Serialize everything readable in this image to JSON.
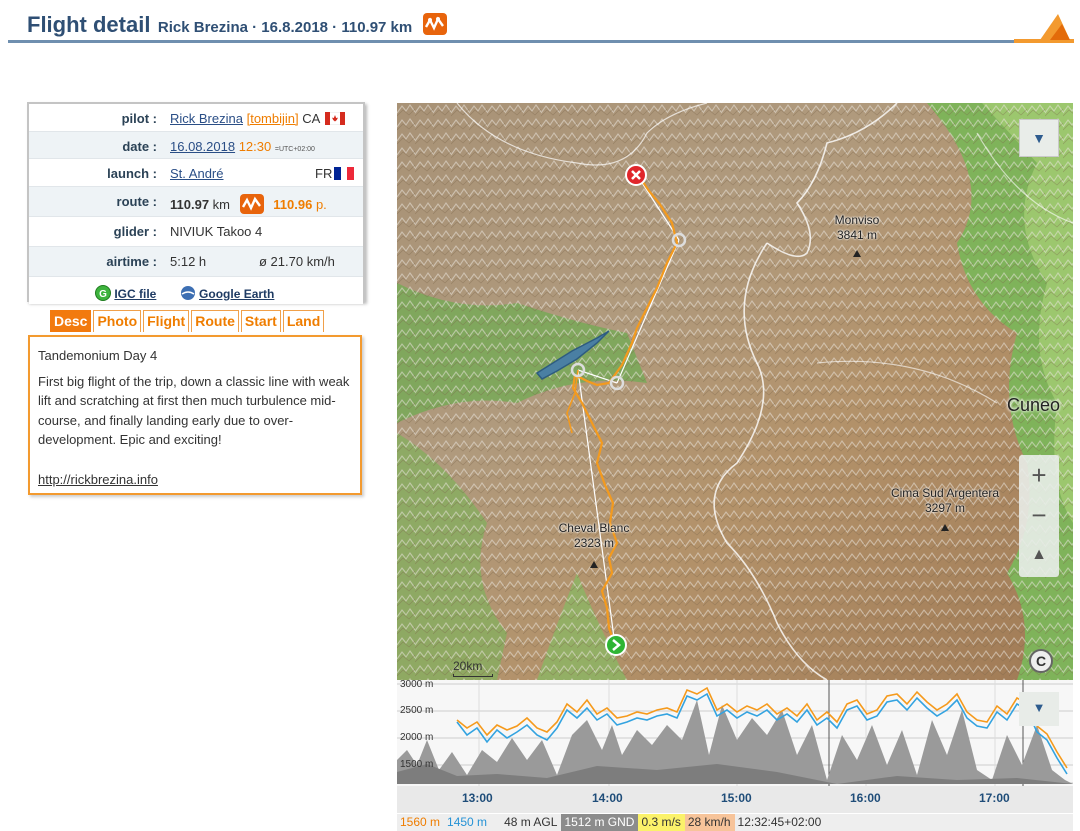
{
  "header": {
    "title": "Flight detail",
    "subtitle": "Rick Brezina · 16.8.2018 · 110.97 km"
  },
  "colors": {
    "accent": "#ef7d00",
    "header_text": "#2f4f74",
    "row_label": "#2b4256"
  },
  "info": {
    "pilot": {
      "label": "pilot :",
      "name": "Rick Brezina",
      "username": "[tombijin]",
      "country": "CA"
    },
    "date": {
      "label": "date :",
      "date": "16.08.2018",
      "time": "12:30",
      "tz": "=UTC+02:00"
    },
    "launch": {
      "label": "launch :",
      "site": "St. André",
      "country": "FR"
    },
    "route": {
      "label": "route :",
      "distance": "110.97",
      "unit": "km",
      "points": "110.96",
      "points_unit": "p."
    },
    "glider": {
      "label": "glider :",
      "value": "NIVIUK Takoo 4"
    },
    "airtime": {
      "label": "airtime :",
      "duration": "5:12 h",
      "speed": "ø 21.70 km/h"
    },
    "files": {
      "igc": "IGC file",
      "google_earth": "Google Earth"
    }
  },
  "tabs": [
    "Desc",
    "Photo",
    "Flight",
    "Route",
    "Start",
    "Land"
  ],
  "active_tab": "Desc",
  "description": {
    "title": "Tandemonium Day 4",
    "body": "First big flight of the trip, down a classic line with weak lift and scratching at first then much turbulence mid-course, and finally landing early due to over-development. Epic and exciting!",
    "url": "http://rickbrezina.info"
  },
  "map": {
    "peaks": [
      {
        "name": "Monviso",
        "alt": "3841 m"
      },
      {
        "name": "Cima Sud Argentera",
        "alt": "3297 m"
      },
      {
        "name": "Cheval Blanc",
        "alt": "2323 m"
      }
    ],
    "city": "Cuneo",
    "scale": "20km",
    "zoom_in": "+",
    "zoom_out": "−"
  },
  "elevation": {
    "y_labels": [
      "3000 m",
      "2500 m",
      "2000 m",
      "1500 m"
    ],
    "x_labels": [
      "13:00",
      "14:00",
      "15:00",
      "16:00",
      "17:00"
    ]
  },
  "status": {
    "alt_gps": "1560 m",
    "alt_baro": "1450 m",
    "agl": "48 m AGL",
    "gnd": "1512 m GND",
    "vario": "0.3 m/s",
    "speed": "28 km/h",
    "time": "12:32:45+02:00"
  }
}
